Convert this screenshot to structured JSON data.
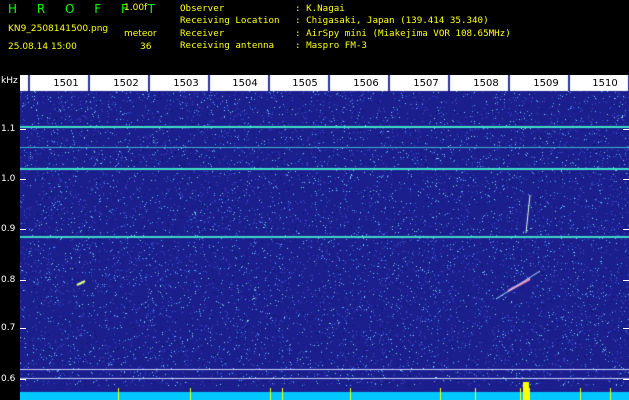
{
  "header": {
    "logo": "H R O F F T",
    "version": "1.00f",
    "filename": "KN9_2508141500.png",
    "meteor_label": "meteor",
    "datetime": "25.08.14 15:00",
    "meteor_count": "36"
  },
  "info": [
    {
      "key": "Observer",
      "value": ": K.Nagai"
    },
    {
      "key": "Receiving Location",
      "value": ": Chigasaki, Japan (139.414 35.340)"
    },
    {
      "key": "Receiver",
      "value": ": AirSpy mini (Miakejima VOR 108.65MHz)"
    },
    {
      "key": "Receiving antenna",
      "value": ": Maspro FM-3"
    }
  ],
  "axis": {
    "y_unit": "kHz",
    "y_labels": [
      "1.1",
      "1.0",
      "0.9",
      "0.8",
      "0.7",
      "0.6"
    ],
    "x_labels": [
      "1501",
      "1502",
      "1503",
      "1504",
      "1505",
      "1506",
      "1507",
      "1508",
      "1509",
      "1510"
    ]
  },
  "colors": {
    "background": "#000000",
    "plot_bg": "#1b1f8e",
    "trace": "#36d8c8",
    "text_yellow": "#ffff00",
    "logo_green": "#00ff00",
    "baseline": "#00c8ff"
  }
}
